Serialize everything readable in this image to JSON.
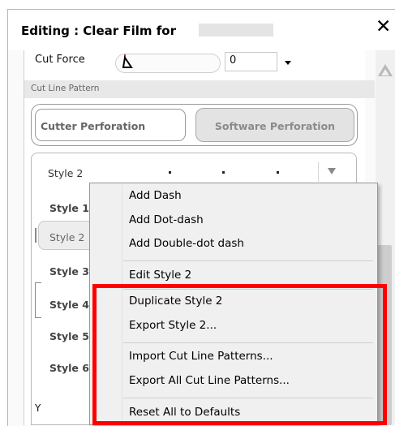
{
  "window": {
    "title": "Editing : Clear Film for",
    "close_glyph": "✕"
  },
  "cut_force": {
    "label": "Cut Force",
    "value": "0"
  },
  "cut_line_pattern": {
    "section_label": "Cut Line Pattern",
    "tabs": [
      {
        "label": "Cutter Perforation",
        "selected": true
      },
      {
        "label": "Software Perforation",
        "selected": false
      }
    ],
    "selected_style": "Style 2",
    "styles": [
      "Style 1",
      "Style 2",
      "Style 3",
      "Style 4",
      "Style 5",
      "Style 6"
    ]
  },
  "context_menu": {
    "items": [
      "Add Dash",
      "Add Dot-dash",
      "Add Double-dot dash",
      "Edit Style 2",
      "Duplicate Style 2",
      "Export Style 2...",
      "Import Cut Line Patterns...",
      "Export All Cut Line Patterns...",
      "Reset All to Defaults"
    ]
  },
  "partial_label": "Y",
  "colors": {
    "highlight": "#ff0000",
    "menu_background": "#f0f0f0",
    "section_background": "#e8e8e8"
  }
}
